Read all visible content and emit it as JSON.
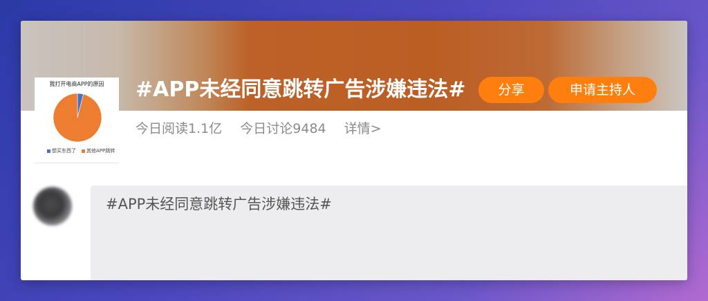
{
  "topic": {
    "title": "#APP未经同意跳转广告涉嫌违法#",
    "share_label": "分享",
    "apply_host_label": "申请主持人",
    "stats": {
      "reads": "今日阅读1.1亿",
      "discussions": "今日讨论9484",
      "details_link": "详情>"
    }
  },
  "thumbnail": {
    "chart_title": "我打开电商APP的原因",
    "chart_data": {
      "type": "pie",
      "title": "我打开电商APP的原因",
      "categories": [
        "想买东西了",
        "其他APP跳转"
      ],
      "values": [
        4,
        96
      ],
      "colors": [
        "#4472c4",
        "#ed7d31"
      ],
      "legend_position": "bottom"
    }
  },
  "composer": {
    "text": "#APP未经同意跳转广告涉嫌违法#"
  },
  "colors": {
    "accent": "#ff7f0e",
    "banner": "#bb5e24",
    "composer_bg": "#ededf0",
    "stats_text": "#8a8a8a"
  }
}
